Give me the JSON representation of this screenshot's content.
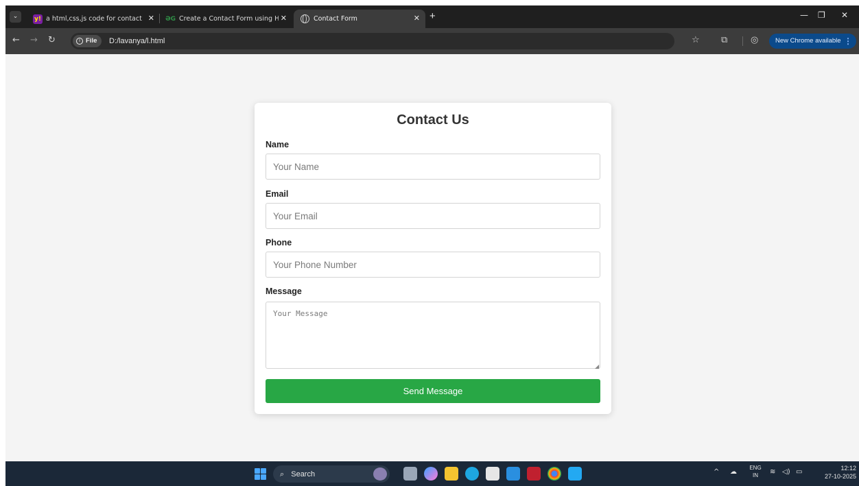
{
  "browser": {
    "tabs": [
      {
        "label": "a html,css,js code for contact fo",
        "active": false,
        "favicon": "yahoo-favicon"
      },
      {
        "label": "Create a Contact Form using HT",
        "active": false,
        "favicon": "gfg-favicon"
      },
      {
        "label": "Contact Form",
        "active": true,
        "favicon": "globe-favicon"
      }
    ],
    "chip_label": "File",
    "url": "D:/lavanya/l.html",
    "update_label": "New Chrome available"
  },
  "form": {
    "title": "Contact Us",
    "name_label": "Name",
    "name_placeholder": "Your Name",
    "email_label": "Email",
    "email_placeholder": "Your Email",
    "phone_label": "Phone",
    "phone_placeholder": "Your Phone Number",
    "message_label": "Message",
    "message_placeholder": "Your Message",
    "submit_label": "Send Message",
    "submit_color": "#28a745"
  },
  "taskbar": {
    "search_label": "Search",
    "lang_primary": "ENG",
    "lang_secondary": "IN",
    "time": "12:12",
    "date": "27-10-2025"
  }
}
